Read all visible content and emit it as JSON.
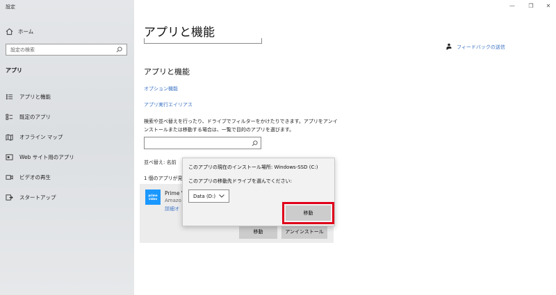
{
  "window": {
    "title": "設定",
    "controls": {
      "minimize": "—",
      "maximize": "❐",
      "close": "✕"
    }
  },
  "sidebar": {
    "home_label": "ホーム",
    "search_placeholder": "設定の検索",
    "section_label": "アプリ",
    "items": [
      {
        "label": "アプリと機能",
        "icon": "apps-list-icon"
      },
      {
        "label": "既定のアプリ",
        "icon": "default-apps-icon"
      },
      {
        "label": "オフライン マップ",
        "icon": "offline-maps-icon"
      },
      {
        "label": "Web サイト用のアプリ",
        "icon": "web-apps-icon"
      },
      {
        "label": "ビデオの再生",
        "icon": "video-playback-icon"
      },
      {
        "label": "スタートアップ",
        "icon": "startup-icon"
      }
    ]
  },
  "main": {
    "page_title": "アプリと機能",
    "feedback_label": "フィードバックの送信",
    "section_heading": "アプリと機能",
    "optional_features_link": "オプション機能",
    "execution_alias_link": "アプリ実行エイリアス",
    "description": "検索や並べ替えを行ったり、ドライブでフィルターをかけたりできます。アプリをアンインストールまたは移動する場合は、一覧で目的のアプリを選びます。",
    "sort_label": "並べ替え: 名前",
    "count_label": "1 個のアプリが見",
    "app": {
      "name": "Prime V",
      "publisher": "Amazo",
      "detail_link": "詳細オ",
      "icon_text": "prime video"
    },
    "move_button": "移動",
    "uninstall_button": "アンインストール"
  },
  "popup": {
    "location_line": "このアプリの現在のインストール場所: Windows-SSD (C:)",
    "choose_line": "このアプリの移動先ドライブを選んでください:",
    "selected_drive": "Data (D:)",
    "move_button": "移動"
  },
  "colors": {
    "accent": "#3a72c4",
    "highlight": "#e0001a",
    "app_icon": "#1a98ff"
  }
}
